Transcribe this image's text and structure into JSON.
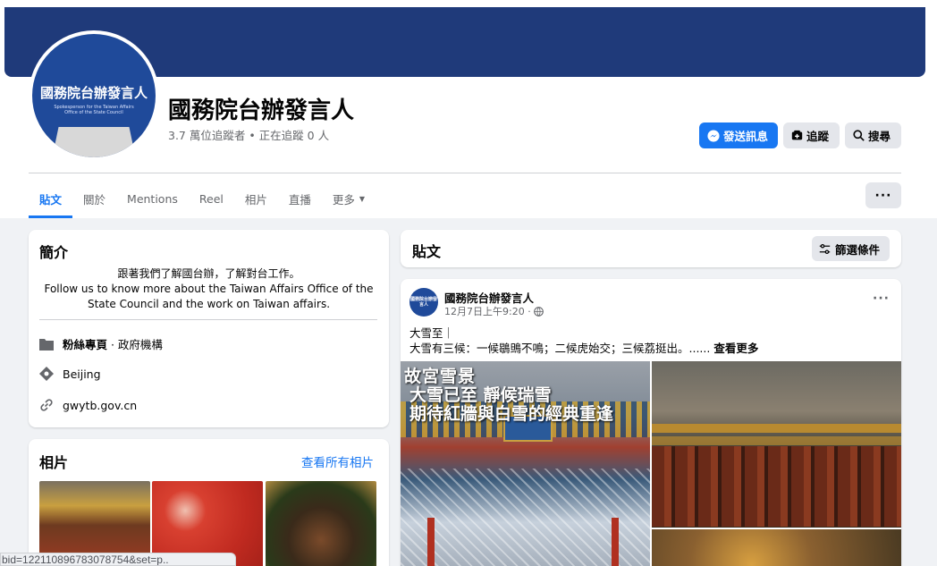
{
  "page": {
    "name": "國務院台辦發言人",
    "stats": "3.7 萬位追蹤者 • 正在追蹤 0 人",
    "avatar_title": "國務院台辦發言人",
    "avatar_subtitle": "Spokesperson for the Taiwan Affairs Office of the State Council",
    "cover_color": "#1f3a7a"
  },
  "actions": {
    "message": "發送訊息",
    "follow": "追蹤",
    "search": "搜尋"
  },
  "tabs": [
    {
      "label": "貼文",
      "active": true
    },
    {
      "label": "關於"
    },
    {
      "label": "Mentions"
    },
    {
      "label": "Reel"
    },
    {
      "label": "相片"
    },
    {
      "label": "直播"
    },
    {
      "label": "更多"
    }
  ],
  "more_button": "···",
  "intro": {
    "title": "簡介",
    "desc_line1": "跟著我們了解國台辦，了解對台工作。",
    "desc_line2": "Follow us to know more about the Taiwan Affairs Office of the State Council and the work on Taiwan affairs.",
    "category_strong": "粉絲專頁",
    "category_rest": " · 政府機構",
    "location": "Beijing",
    "website": "gwytb.gov.cn"
  },
  "photos": {
    "title": "相片",
    "see_all": "查看所有相片"
  },
  "posts": {
    "title": "貼文",
    "filter": "篩選條件"
  },
  "post": {
    "author": "國務院台辦發言人",
    "time": "12月7日上午9:20 ·",
    "menu": "···",
    "text_line1": "大雪至｜",
    "text_line2": "大雪有三候：一候鶡鴠不鳴；二候虎始交；三候荔挺出。......",
    "see_more": "查看更多",
    "image_caption_1": "故宮雪景",
    "image_caption_2": "大雪已至 靜候瑞雪",
    "image_caption_3": "期待紅牆與白雪的經典重逢"
  },
  "url_overlay": "bid=122110896783078754&set=p..",
  "colors": {
    "accent": "#1877f2",
    "background": "#f0f2f5",
    "secondary_text": "#65676b"
  }
}
